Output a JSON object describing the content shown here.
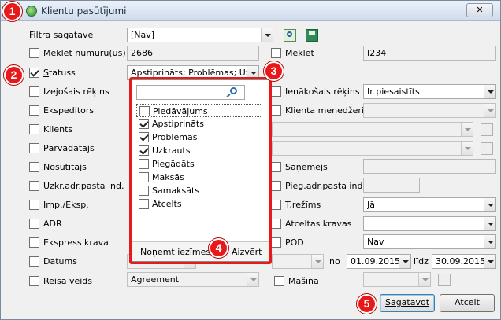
{
  "window": {
    "title": "Klientu pasūtījumi",
    "close_label": "✕"
  },
  "badges": [
    "1",
    "2",
    "3",
    "4",
    "5"
  ],
  "filtra": {
    "label": "Filtra sagatave",
    "value": "[Nav]"
  },
  "fields": {
    "meklet_numuru": {
      "label": "Meklēt numuru(us)",
      "value": "2686"
    },
    "meklet": {
      "label": "Meklēt",
      "value": "I234"
    },
    "statuss": {
      "label": "Statuss",
      "value": "Apstiprināts; Problēmas; Uzkra"
    },
    "izejosais": {
      "label": "Izejošais rēķins"
    },
    "ienakosais": {
      "label": "Ienākošais rēķins",
      "value": "Ir piesaistīts"
    },
    "ekspeditors": {
      "label": "Ekspeditors"
    },
    "klienta_menedzeris": {
      "label": "Klienta menedžeris"
    },
    "klients": {
      "label": "Klients"
    },
    "parvadatajs": {
      "label": "Pārvadātājs"
    },
    "nosutitajs": {
      "label": "Nosūtītājs"
    },
    "sanemejs": {
      "label": "Saņēmējs"
    },
    "uzkr_adr": {
      "label": "Uzkr.adr.pasta ind."
    },
    "pieg_adr": {
      "label": "Pieg.adr.pasta ind."
    },
    "imp_eksp": {
      "label": "Imp./Eksp."
    },
    "t_rezims": {
      "label": "T.režīms",
      "value": "Jā"
    },
    "adr": {
      "label": "ADR"
    },
    "atceltas_kravas": {
      "label": "Atceltas kravas"
    },
    "ekspress_krava": {
      "label": "Ekspress krava"
    },
    "pod": {
      "label": "POD",
      "value": "Nav"
    },
    "datums": {
      "label": "Datums",
      "no_label": "no",
      "from": "01.09.2015",
      "lidz_label": "līdz",
      "to": "30.09.2015"
    },
    "reisa_veids": {
      "label": "Reisa veids",
      "value": "Agreement"
    },
    "masina": {
      "label": "Mašīna"
    }
  },
  "status_dropdown": {
    "search_value": "",
    "options": [
      {
        "label": "Piedāvājums",
        "checked": false
      },
      {
        "label": "Apstiprināts",
        "checked": true
      },
      {
        "label": "Problēmas",
        "checked": true
      },
      {
        "label": "Uzkrauts",
        "checked": true
      },
      {
        "label": "Piegādāts",
        "checked": false
      },
      {
        "label": "Maksās",
        "checked": false
      },
      {
        "label": "Samaksāts",
        "checked": false
      },
      {
        "label": "Atcelts",
        "checked": false
      }
    ],
    "clear_label": "Noņemt iezīmes",
    "close_label": "Aizvērt"
  },
  "buttons": {
    "sagatavot": "Sagatavot",
    "atcelt": "Atcelt"
  },
  "colors": {
    "badge": "#e8191b",
    "highlight_border": "#e8191b",
    "title_gradient_top": "#eaf1fb"
  }
}
